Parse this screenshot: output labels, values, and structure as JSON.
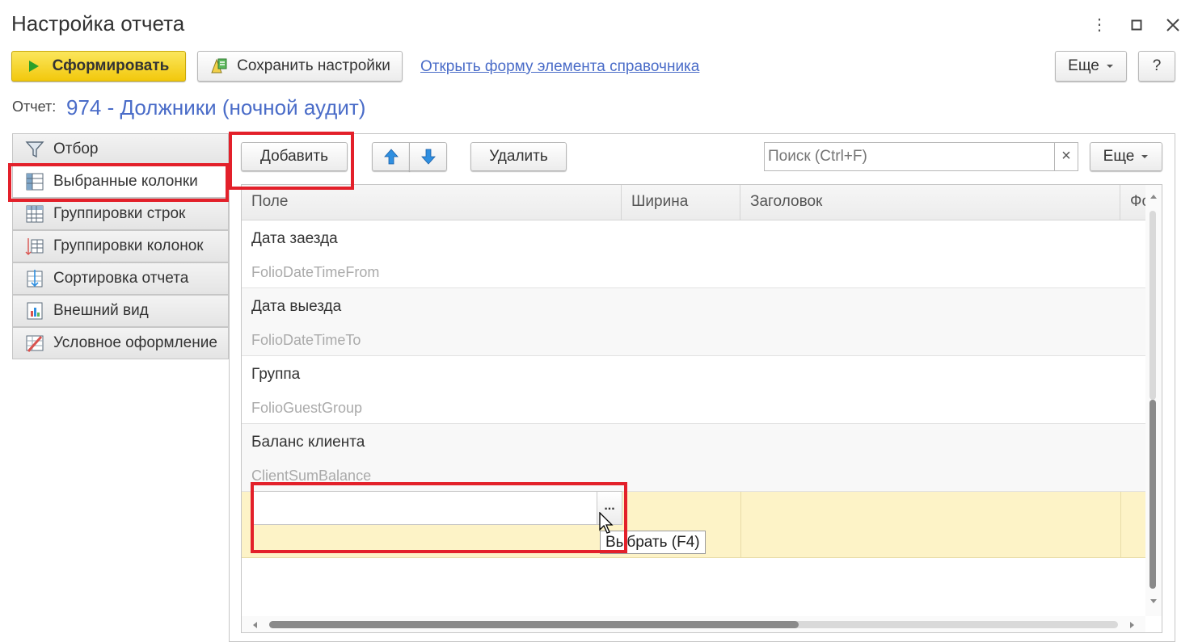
{
  "window": {
    "title": "Настройка отчета",
    "controls": {
      "more_label": "⋮",
      "maximize_label": "☐",
      "close_label": "✕"
    }
  },
  "toolbar": {
    "generate_label": "Сформировать",
    "save_settings_label": "Сохранить настройки",
    "open_form_link": "Открыть форму элемента справочника",
    "more_label": "Еще",
    "help_label": "?"
  },
  "report": {
    "label": "Отчет:",
    "value": "974 - Должники (ночной аудит)"
  },
  "tabs": [
    {
      "label": "Отбор",
      "icon": "filter-icon"
    },
    {
      "label": "Выбранные колонки",
      "icon": "columns-icon",
      "active": true
    },
    {
      "label": "Группировки строк",
      "icon": "row-groups-icon"
    },
    {
      "label": "Группировки колонок",
      "icon": "column-groups-icon"
    },
    {
      "label": "Сортировка отчета",
      "icon": "sort-icon"
    },
    {
      "label": "Внешний вид",
      "icon": "appearance-icon"
    },
    {
      "label": "Условное оформление",
      "icon": "conditional-format-icon"
    }
  ],
  "panel_toolbar": {
    "add_label": "Добавить",
    "up_icon": "arrow-up-icon",
    "down_icon": "arrow-down-icon",
    "delete_label": "Удалить",
    "search_placeholder": "Поиск (Ctrl+F)",
    "clear_label": "×",
    "more_label": "Еще"
  },
  "table": {
    "columns": [
      "Поле",
      "Ширина",
      "Заголовок",
      "Фо"
    ],
    "rows": [
      {
        "name": "Дата заезда",
        "code": "FolioDateTimeFrom"
      },
      {
        "name": "Дата выезда",
        "code": "FolioDateTimeTo"
      },
      {
        "name": "Группа",
        "code": "FolioGuestGroup"
      },
      {
        "name": "Баланс клиента",
        "code": "ClientSumBalance"
      }
    ],
    "new_row": {
      "value": "",
      "choose_button_label": "...",
      "tooltip": "Выбрать (F4)"
    }
  },
  "colors": {
    "accent_link": "#4a6cc8",
    "primary_button": "#f2c80c",
    "highlight_row": "#fdf3c7",
    "annotation_red": "#e3202a",
    "arrow_blue": "#2f8fe0"
  }
}
